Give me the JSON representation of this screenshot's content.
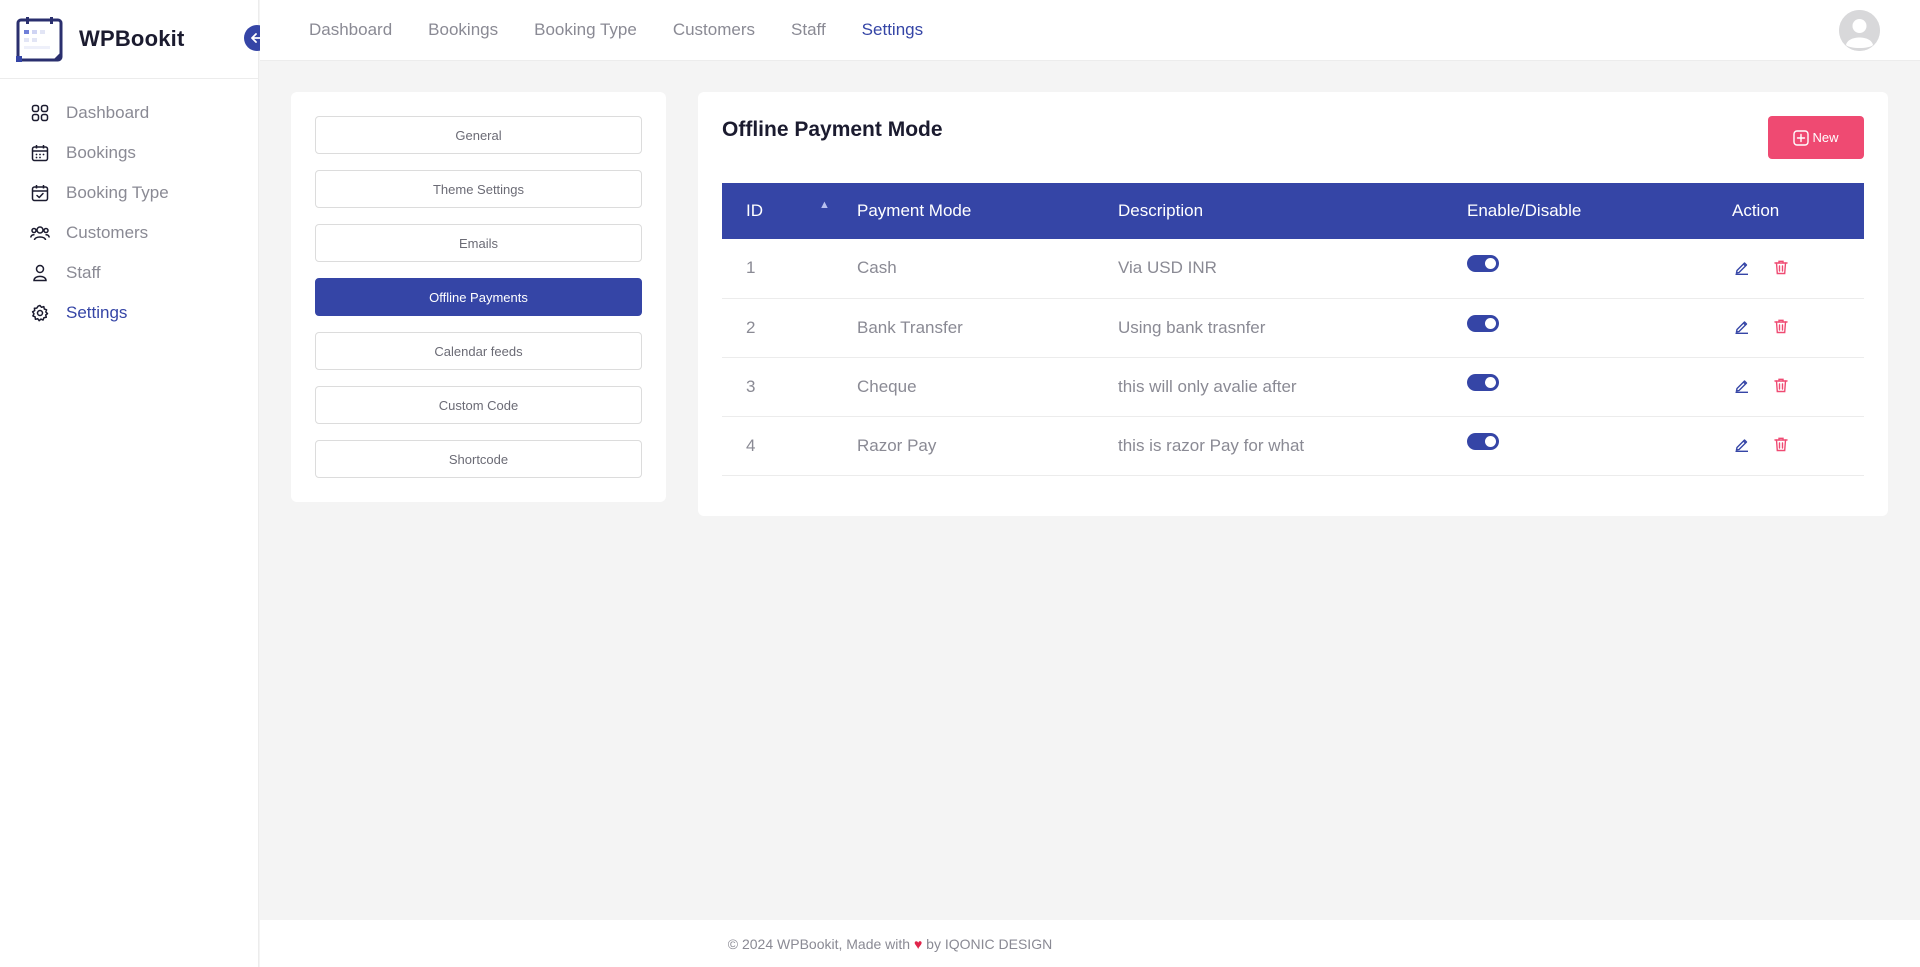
{
  "brand": {
    "name": "WPBookit"
  },
  "sidebar": {
    "items": [
      {
        "label": "Dashboard",
        "icon": "dashboard-grid-icon"
      },
      {
        "label": "Bookings",
        "icon": "calendar-icon"
      },
      {
        "label": "Booking Type",
        "icon": "calendar-check-icon"
      },
      {
        "label": "Customers",
        "icon": "users-icon"
      },
      {
        "label": "Staff",
        "icon": "user-icon"
      },
      {
        "label": "Settings",
        "icon": "gear-icon",
        "active": true
      }
    ]
  },
  "topnav": {
    "links": [
      "Dashboard",
      "Bookings",
      "Booking Type",
      "Customers",
      "Staff",
      "Settings"
    ],
    "active": "Settings"
  },
  "settings_menu": {
    "items": [
      "General",
      "Theme Settings",
      "Emails",
      "Offline Payments",
      "Calendar feeds",
      "Custom Code",
      "Shortcode"
    ],
    "active": "Offline Payments"
  },
  "main": {
    "title": "Offline Payment Mode",
    "new_label": "New",
    "columns": [
      "ID",
      "Payment Mode",
      "Description",
      "Enable/Disable",
      "Action"
    ],
    "rows": [
      {
        "id": "1",
        "mode": "Cash",
        "description": "Via USD INR",
        "enabled": true
      },
      {
        "id": "2",
        "mode": "Bank Transfer",
        "description": "Using bank trasnfer",
        "enabled": true
      },
      {
        "id": "3",
        "mode": "Cheque",
        "description": "this will only avalie after",
        "enabled": true
      },
      {
        "id": "4",
        "mode": "Razor Pay",
        "description": "this is razor Pay for what",
        "enabled": true
      }
    ]
  },
  "footer": {
    "prefix": "© 2024 WPBookit, Made with",
    "suffix": "by IQONIC DESIGN"
  },
  "colors": {
    "primary": "#3545a6",
    "accent": "#ef4a72",
    "heart": "#e0254b"
  }
}
